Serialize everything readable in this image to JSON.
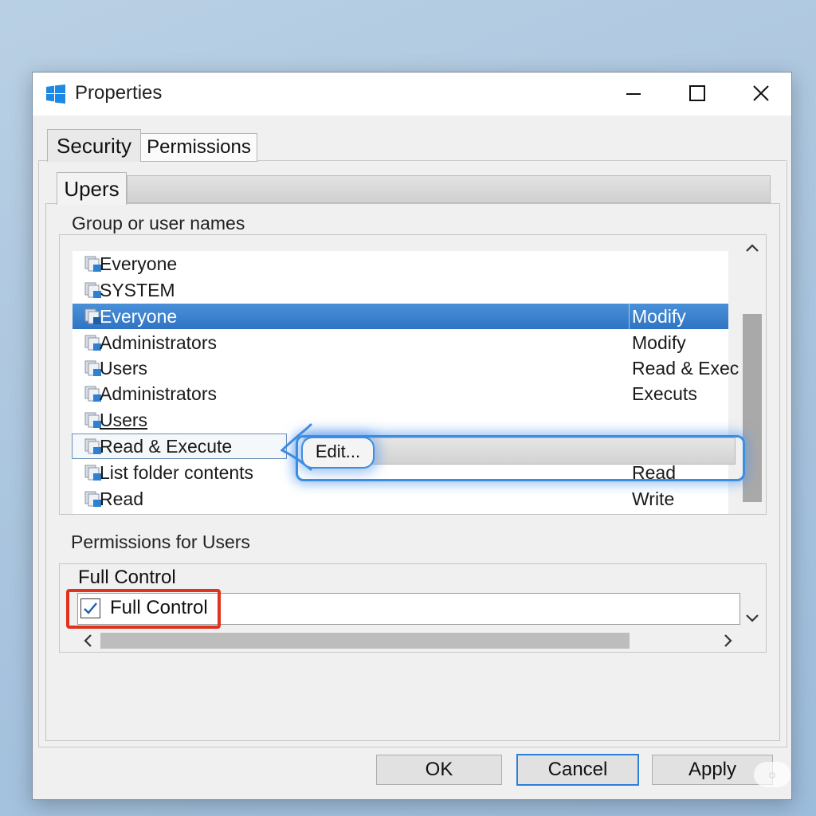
{
  "window": {
    "title": "Properties",
    "accent_color": "#3b8ee0",
    "selection_color": "#2f74c4"
  },
  "tabs": [
    {
      "label": "Security",
      "active": true
    },
    {
      "label": "Permissions",
      "active": false
    }
  ],
  "sub_tabs": [
    {
      "label": "Upers",
      "active": true
    }
  ],
  "group_section": {
    "label": "Group or user names",
    "rows": [
      {
        "name": "Everyone",
        "permission": "",
        "state": "normal",
        "icon": "user-group-icon"
      },
      {
        "name": "SYSTEM",
        "permission": "",
        "state": "normal",
        "icon": "user-group-icon"
      },
      {
        "name": "Everyone",
        "permission": "Modify",
        "state": "selected",
        "icon": "user-group-icon"
      },
      {
        "name": "Administrators",
        "permission": "Modify",
        "state": "normal",
        "icon": "user-group-icon"
      },
      {
        "name": "Users",
        "permission": "Read & Exec",
        "state": "normal",
        "icon": "user-group-icon"
      },
      {
        "name": "Administrators",
        "permission": "Executs",
        "state": "normal",
        "icon": "user-group-icon"
      },
      {
        "name": "Users",
        "permission": "",
        "state": "normal",
        "icon": "user-group-icon"
      },
      {
        "name": "Read & Execute",
        "permission": "",
        "state": "boxed",
        "icon": "user-group-icon"
      },
      {
        "name": "List folder contents",
        "permission": "Read",
        "state": "normal",
        "icon": "user-group-icon"
      },
      {
        "name": "Read",
        "permission": "Write",
        "state": "normal",
        "icon": "user-group-icon"
      }
    ],
    "edit_button_label": "Edit..."
  },
  "permissions_section": {
    "label": "Permissions for Users",
    "column_header": "Full Control",
    "entry": {
      "label": "Full Control",
      "checked": true
    }
  },
  "buttons": {
    "ok": "OK",
    "cancel": "Cancel",
    "apply": "Apply"
  }
}
